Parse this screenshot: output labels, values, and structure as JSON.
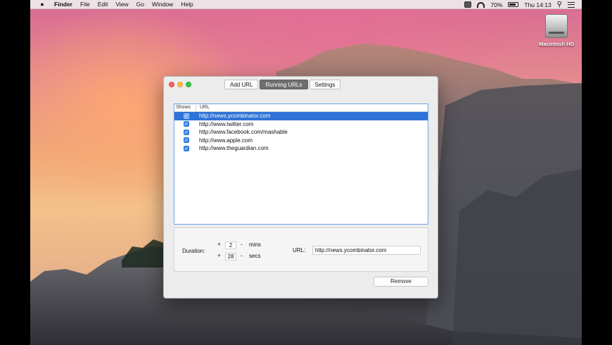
{
  "menubar": {
    "app_name": "Finder",
    "items": [
      "File",
      "Edit",
      "View",
      "Go",
      "Window",
      "Help"
    ],
    "battery": "70%",
    "clock": "Thu 14:13",
    "icons": [
      "apple-logo",
      "disk-icon",
      "wifi-icon",
      "battery-icon",
      "search-icon",
      "list-icon"
    ]
  },
  "desktop": {
    "drive_label": "Macintosh HD"
  },
  "window": {
    "tabs": [
      "Add URL",
      "Running URLs",
      "Settings"
    ],
    "active_tab": "Running URLs",
    "table": {
      "headers": [
        "Shows",
        "URL"
      ],
      "rows": [
        {
          "checked": true,
          "url": "http://news.ycombinator.com",
          "selected": true
        },
        {
          "checked": true,
          "url": "http://www.twitter.com",
          "selected": false
        },
        {
          "checked": true,
          "url": "http://www.facebook.com/mashable",
          "selected": false
        },
        {
          "checked": true,
          "url": "http://www.apple.com",
          "selected": false
        },
        {
          "checked": true,
          "url": "http://www.theguardian.com",
          "selected": false
        }
      ]
    },
    "duration": {
      "label": "Duration:",
      "mins_value": "2",
      "mins_unit": "mins",
      "secs_value": "28",
      "secs_unit": "secs",
      "plus": "+",
      "minus": "-"
    },
    "url_field": {
      "label": "URL:",
      "value": "http://news.ycombinator.com"
    },
    "remove_label": "Remove"
  },
  "colors": {
    "selection": "#2f73d6",
    "checkbox": "#3a8ef2",
    "focus_ring": "#6aa4ea"
  }
}
